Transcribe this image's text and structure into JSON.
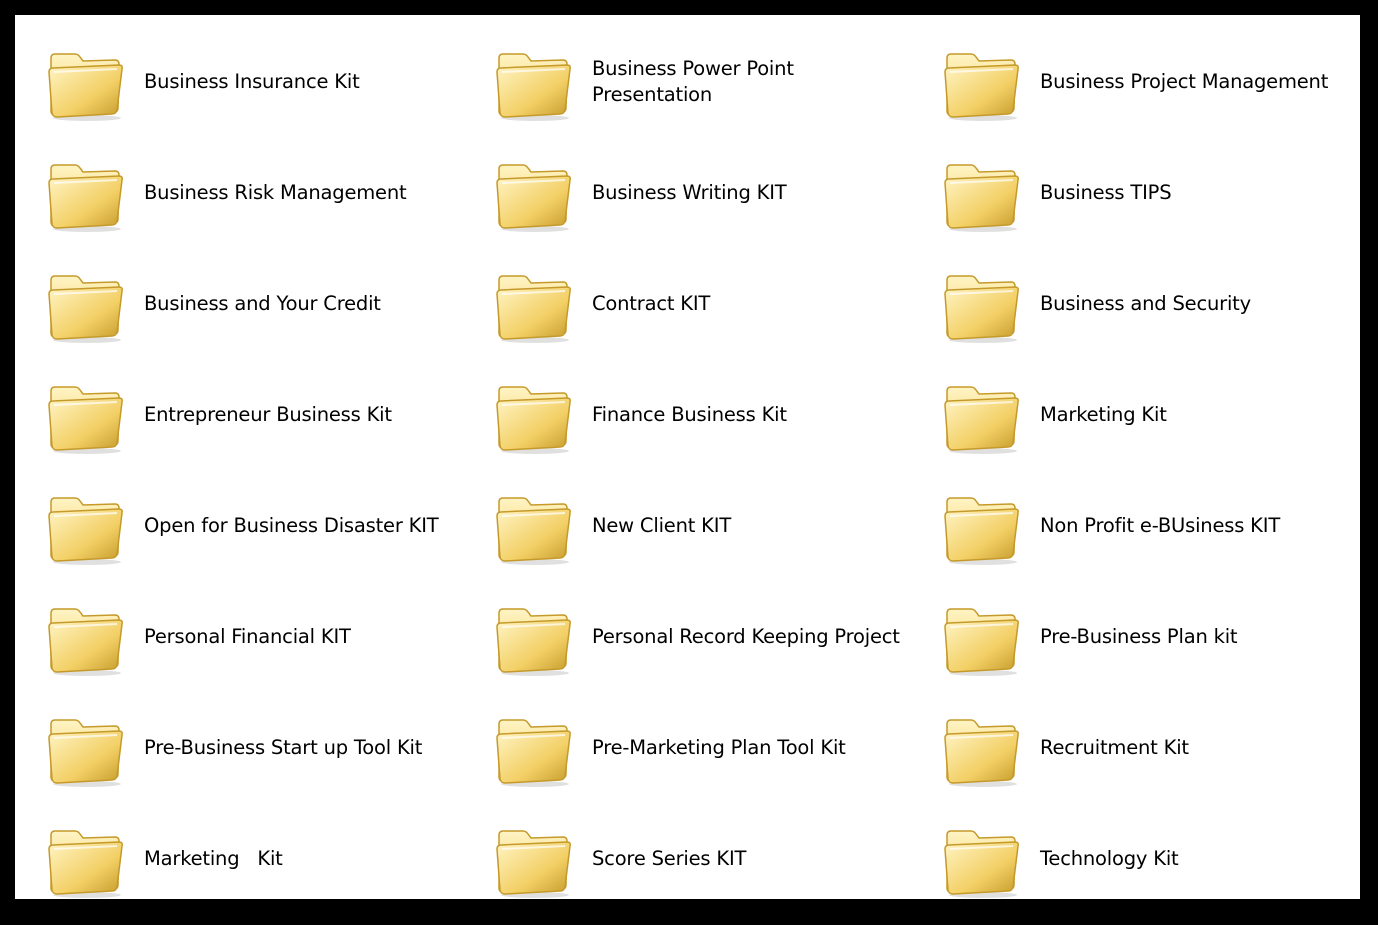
{
  "window": {
    "colors": {
      "border": "#000000",
      "background": "#ffffff",
      "folder_body": "#f3d066",
      "folder_light": "#fff4c4",
      "folder_edge": "#c59a2a"
    }
  },
  "folders": [
    {
      "label": "Business Insurance Kit",
      "icon": "folder-icon"
    },
    {
      "label": "Business Power Point\nPresentation",
      "icon": "folder-icon"
    },
    {
      "label": "Business Project Management",
      "icon": "folder-icon"
    },
    {
      "label": "Business Risk Management",
      "icon": "folder-icon"
    },
    {
      "label": "Business Writing KIT",
      "icon": "folder-icon"
    },
    {
      "label": "Business TIPS",
      "icon": "folder-icon"
    },
    {
      "label": "Business and Your Credit",
      "icon": "folder-icon"
    },
    {
      "label": "Contract KIT",
      "icon": "folder-icon"
    },
    {
      "label": "Business and Security",
      "icon": "folder-icon"
    },
    {
      "label": "Entrepreneur Business Kit",
      "icon": "folder-icon"
    },
    {
      "label": "Finance Business Kit",
      "icon": "folder-icon"
    },
    {
      "label": "Marketing Kit",
      "icon": "folder-icon"
    },
    {
      "label": "Open for Business Disaster KIT",
      "icon": "folder-icon"
    },
    {
      "label": "New Client KIT",
      "icon": "folder-icon"
    },
    {
      "label": "Non Profit e-BUsiness KIT",
      "icon": "folder-icon"
    },
    {
      "label": "Personal Financial KIT",
      "icon": "folder-icon"
    },
    {
      "label": "Personal Record Keeping Project",
      "icon": "folder-icon"
    },
    {
      "label": "Pre-Business Plan kit",
      "icon": "folder-icon"
    },
    {
      "label": "Pre-Business Start up Tool Kit",
      "icon": "folder-icon"
    },
    {
      "label": "Pre-Marketing Plan Tool Kit",
      "icon": "folder-icon"
    },
    {
      "label": "Recruitment Kit",
      "icon": "folder-icon"
    },
    {
      "label": "Marketing   Kit",
      "icon": "folder-icon"
    },
    {
      "label": "Score Series KIT",
      "icon": "folder-icon"
    },
    {
      "label": "Technology Kit",
      "icon": "folder-icon"
    }
  ]
}
